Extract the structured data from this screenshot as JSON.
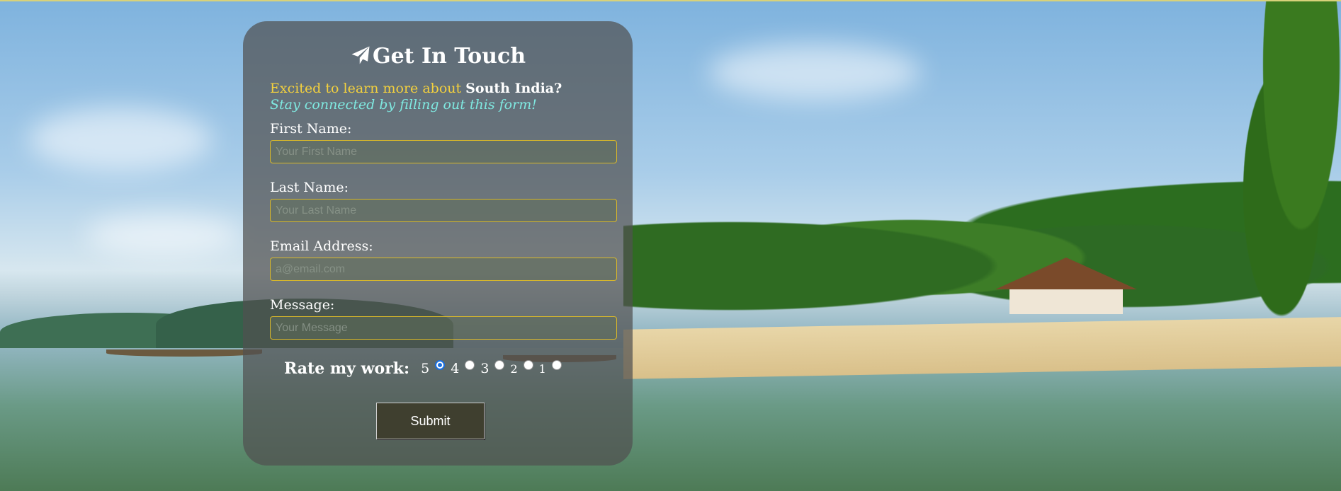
{
  "form": {
    "title": "Get In Touch",
    "intro_prefix": "Excited to learn more about ",
    "intro_highlight": "South India?",
    "subtitle": "Stay connected by filling out this form!",
    "fields": [
      {
        "label": "First Name:",
        "placeholder": "Your First Name"
      },
      {
        "label": "Last Name:",
        "placeholder": "Your Last Name"
      },
      {
        "label": "Email Address:",
        "placeholder": "a@email.com"
      },
      {
        "label": "Message:",
        "placeholder": "Your Message"
      }
    ],
    "rating": {
      "label": "Rate my work:",
      "options": [
        "5",
        "4",
        "3",
        "2",
        "1"
      ],
      "selected": "5"
    },
    "submit_label": "Submit"
  },
  "colors": {
    "intro_yellow": "#f3d03e",
    "subtitle_teal": "#7fe8e0",
    "field_border": "#d9b82a",
    "radio_selected": "#1a6fe0"
  },
  "icons": {
    "title_icon": "paper-plane-icon"
  }
}
